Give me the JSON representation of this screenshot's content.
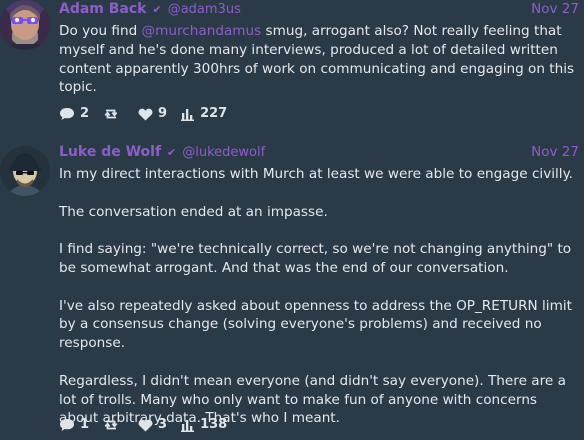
{
  "posts": [
    {
      "author": {
        "display_name": "Adam Back",
        "verified_icon": "check-icon",
        "handle": "@adam3us",
        "avatar": "avatar-adam"
      },
      "date": "Nov 27",
      "content": {
        "pre": "Do you find ",
        "mention": "@murchandamus",
        "post": " smug, arrogant also? Not really feeling that myself and he's done many interviews, produced a lot of detailed written content apparently 300hrs of work on communicating and engaging on this topic."
      },
      "actions": {
        "replies": "2",
        "reposts": "",
        "likes": "9",
        "views": "227"
      }
    },
    {
      "author": {
        "display_name": "Luke de Wolf",
        "verified_icon": "check-icon",
        "handle": "@lukedewolf",
        "avatar": "avatar-luke"
      },
      "date": "Nov 27",
      "paragraphs": [
        "In my direct interactions with Murch at least we were able to engage civilly.",
        "The conversation ended at an impasse.",
        "I find saying: \"we're technically correct, so we're not changing anything\" to be somewhat arrogant. And that was the end of our conversation.",
        "I've also repeatedly asked about openness to address the OP_RETURN limit by a consensus change (solving everyone's problems) and received no response.",
        "Regardless, I didn't mean everyone (and didn't say everyone). There are a lot of trolls. Many who only want to make fun of anyone with concerns about arbitrary data. That's who I meant."
      ],
      "actions": {
        "replies": "1",
        "reposts": "",
        "likes": "3",
        "views": "138"
      }
    }
  ],
  "icons": {
    "reply": "speech-bubble-icon",
    "repost": "repost-icon",
    "like": "heart-icon",
    "views": "bar-chart-icon"
  },
  "colors": {
    "background": "#2b3a47",
    "accent": "#8b5fc9",
    "text": "#e4e8ec"
  }
}
